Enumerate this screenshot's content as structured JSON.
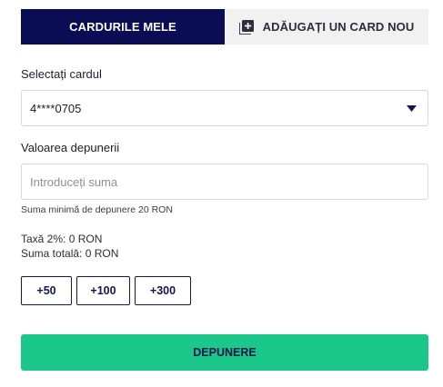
{
  "tabs": {
    "my_cards_label": "CARDURILE MELE",
    "add_card_label": "ADĂUGAȚI UN CARD NOU",
    "add_card_icon": "add-box-icon"
  },
  "form": {
    "select_card_label": "Selectați cardul",
    "selected_card": "4****0705",
    "select_icon": "caret-down-icon",
    "amount_label": "Valoarea depunerii",
    "amount_placeholder": "Introduceți suma",
    "amount_value": "",
    "min_deposit_hint": "Suma minimă de depunere 20 RON",
    "fee_text": "Taxă 2%: 0 RON",
    "total_text": "Suma totală: 0 RON"
  },
  "quick_amounts": [
    "+50",
    "+100",
    "+300"
  ],
  "submit_label": "DEPUNERE",
  "colors": {
    "active_tab": "#0b0d54",
    "inactive_tab": "#f1f1f2",
    "submit": "#1bc88a",
    "text_dark": "#14164f"
  }
}
